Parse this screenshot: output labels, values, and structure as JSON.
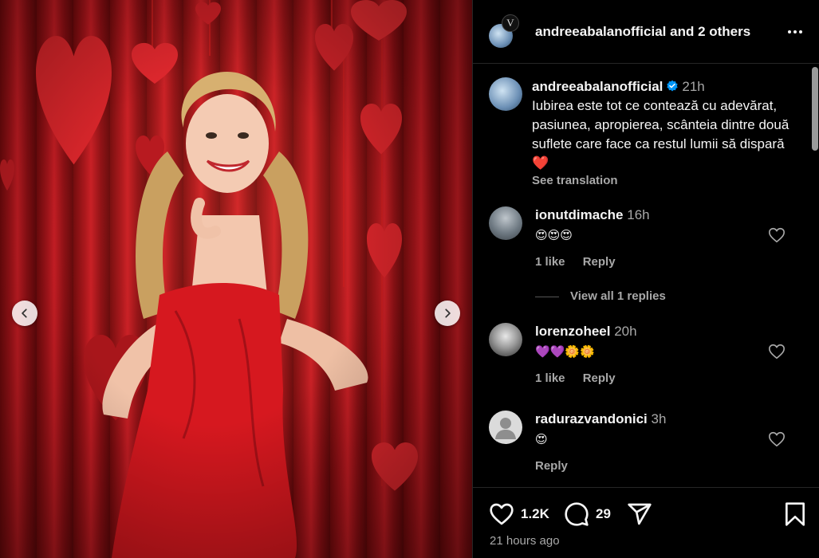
{
  "header": {
    "username": "andreeabalanofficial",
    "others": "and 2 others",
    "collab_initial": "V"
  },
  "caption": {
    "username": "andreeabalanofficial",
    "time": "21h",
    "text": "Iubirea este tot ce contează cu adevărat, pasiunea, apropierea, scânteia dintre două suflete care face ca restul lumii să dispară ❤️",
    "see_translation": "See translation"
  },
  "comments": [
    {
      "username": "ionutdimache",
      "time": "16h",
      "text": "😍😍😍",
      "likes": "1 like",
      "reply": "Reply"
    },
    {
      "username": "lorenzoheel",
      "time": "20h",
      "text": "💜💜🌼🌼",
      "likes": "1 like",
      "reply": "Reply"
    },
    {
      "username": "radurazvandonici",
      "time": "3h",
      "text": "😍",
      "reply": "Reply"
    }
  ],
  "view_replies": "View all 1 replies",
  "footer": {
    "likes": "1.2K",
    "comments": "29",
    "timestamp": "21 hours ago"
  },
  "colors": {
    "background": "#000000",
    "text": "#f5f5f5",
    "muted": "#a8a8a8",
    "verified": "#0095f6",
    "photo_red": "#c51d24"
  },
  "icons": [
    "more-icon",
    "verified-badge-icon",
    "heart-icon",
    "comment-icon",
    "share-icon",
    "bookmark-icon",
    "chevron-left-icon",
    "chevron-right-icon"
  ]
}
